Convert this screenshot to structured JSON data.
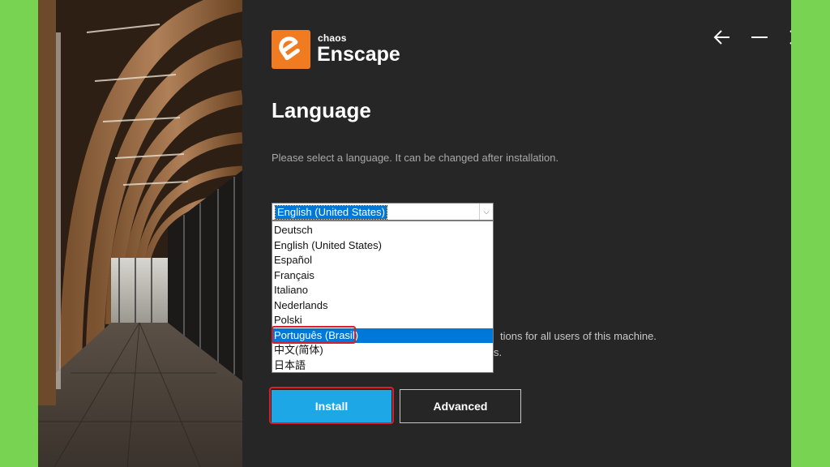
{
  "brand": {
    "small": "chaos",
    "name": "Enscape",
    "accent": "#f07b21"
  },
  "window_controls": {
    "back_icon": "arrow-left-icon",
    "minimize_icon": "minimize-icon",
    "close_icon": "close-icon"
  },
  "page": {
    "title": "Language",
    "subtitle": "Please select a language. It can be changed after installation."
  },
  "language_select": {
    "selected": "English (United States)",
    "options": [
      "Deutsch",
      "English (United States)",
      "Español",
      "Français",
      "Italiano",
      "Nederlands",
      "Polski",
      "Português (Brasil)",
      "中文(简体)",
      "日本語"
    ],
    "hover_option": "Português (Brasil)"
  },
  "partially_hidden_text": {
    "line1": "tions for all users of this machine.",
    "line2": "s."
  },
  "buttons": {
    "install": "Install",
    "advanced": "Advanced"
  },
  "colors": {
    "background_frame": "#79d353",
    "window": "#262626",
    "primary_button": "#1ea7e6",
    "highlight_annotation": "#d9202a"
  }
}
